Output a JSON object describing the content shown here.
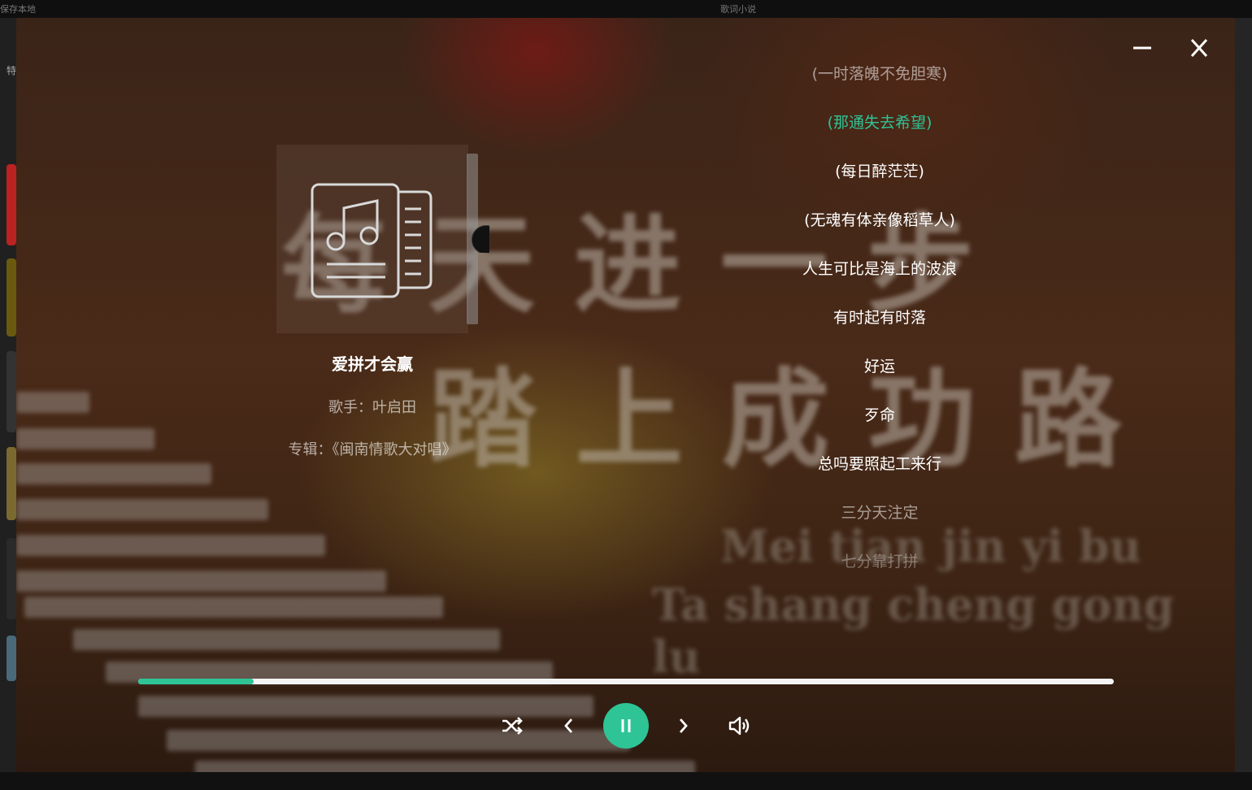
{
  "window": {
    "bg_left_text": "保存本地",
    "bg_center_text": "歌词小说",
    "bg_side_label": "特"
  },
  "song": {
    "title": "爱拼才会赢",
    "artist_line": "歌手：叶启田",
    "album_line": "专辑：《闽南情歌大对唱》"
  },
  "background_art": {
    "line1": "每天进一步",
    "line2": "踏上成功路",
    "pinyin1": "Mei tian jin yi bu",
    "pinyin2": "Ta shang cheng gong lu"
  },
  "lyrics": [
    {
      "text": "(一时落魄不免胆寒)",
      "state": "past"
    },
    {
      "text": "(那通失去希望)",
      "state": "current"
    },
    {
      "text": "(每日醉茫茫)",
      "state": "upcoming"
    },
    {
      "text": "(无魂有体亲像稻草人)",
      "state": "upcoming"
    },
    {
      "text": "人生可比是海上的波浪",
      "state": "upcoming"
    },
    {
      "text": "有时起有时落",
      "state": "upcoming"
    },
    {
      "text": "好运",
      "state": "upcoming"
    },
    {
      "text": "歹命",
      "state": "upcoming"
    },
    {
      "text": "总吗要照起工来行",
      "state": "upcoming"
    },
    {
      "text": "三分天注定",
      "state": "dim"
    },
    {
      "text": "七分靠打拼",
      "state": "fade"
    }
  ],
  "playback": {
    "progress_fraction": 0.118,
    "is_playing": true,
    "mode": "shuffle"
  },
  "colors": {
    "accent": "#2ec496",
    "lyric_text": "#ffffff",
    "progress_track": "#f4f4f4"
  },
  "icons": {
    "minimize": "minimize-icon",
    "close": "close-icon",
    "cover": "music-note-icon",
    "shuffle": "shuffle-icon",
    "prev": "chevron-left-icon",
    "play_pause": "pause-icon",
    "next": "chevron-right-icon",
    "volume": "volume-icon"
  }
}
